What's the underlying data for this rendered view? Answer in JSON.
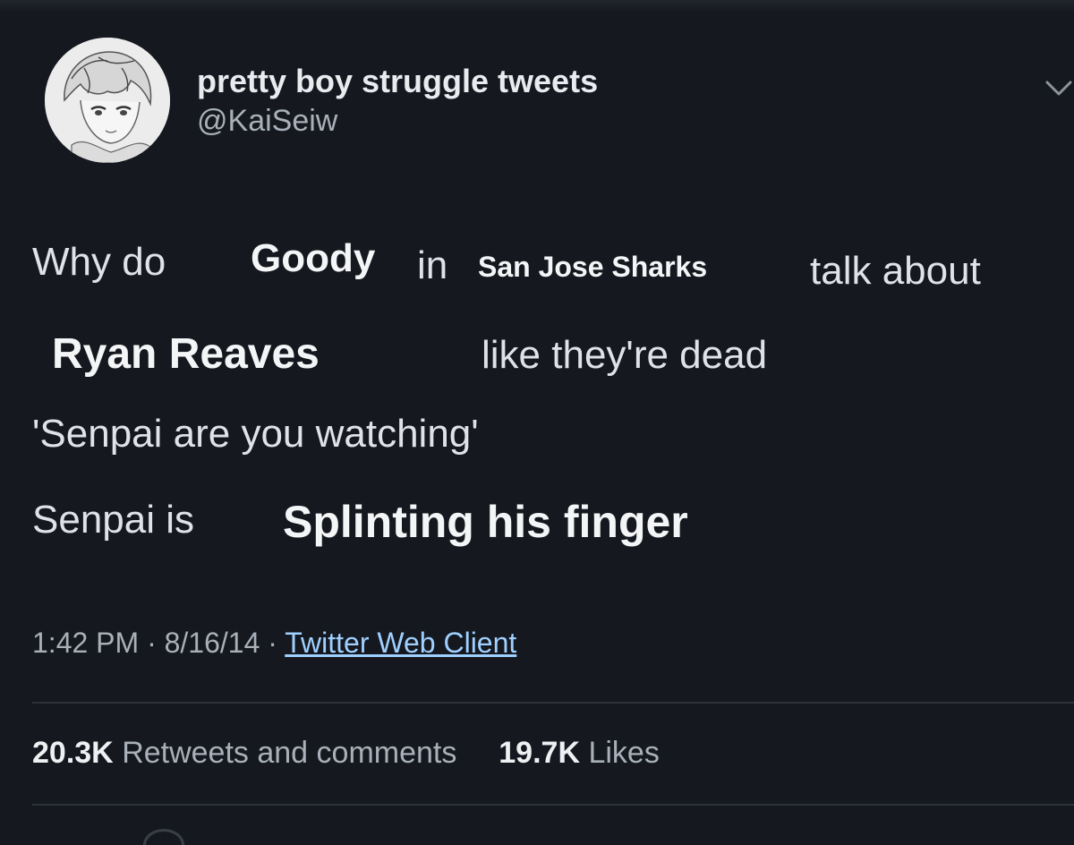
{
  "user": {
    "display_name": "pretty boy struggle tweets",
    "handle": "@KaiSeiw"
  },
  "icons": {
    "avatar": "anime-avatar-icon",
    "menu": "chevron-down-icon"
  },
  "tweet": {
    "line1": {
      "a": "Why do",
      "b": "Goody",
      "c": "in",
      "d": "San Jose Sharks",
      "e": "talk about"
    },
    "line2": {
      "a": "Ryan Reaves",
      "b": "like they're dead"
    },
    "line3": "'Senpai are you watching'",
    "line4": {
      "a": "Senpai is",
      "b": "Splinting his finger"
    }
  },
  "meta": {
    "time": "1:42 PM",
    "sep1": "·",
    "date": "8/16/14",
    "sep2": "·",
    "source": "Twitter Web Client"
  },
  "stats": {
    "retweets_count": "20.3K",
    "retweets_label": "Retweets and comments",
    "likes_count": "19.7K",
    "likes_label": "Likes"
  },
  "colors": {
    "background": "#15181f",
    "link": "#9fd0ff"
  }
}
